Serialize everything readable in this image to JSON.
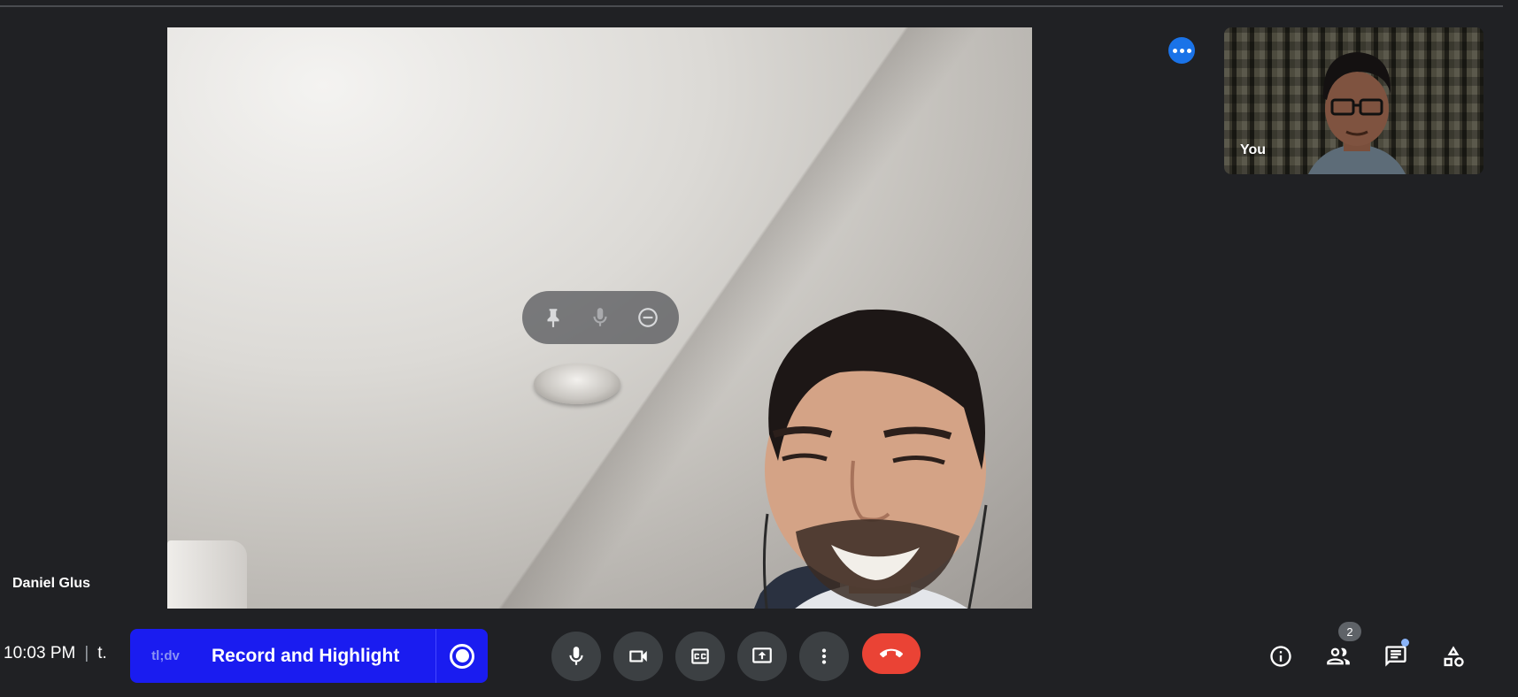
{
  "meeting": {
    "time": "10:03 PM",
    "separator": "|",
    "meeting_code": "t."
  },
  "main_tile": {
    "participant_name": "Daniel Glus",
    "controls": [
      "pin-icon",
      "mic-icon",
      "remove-icon"
    ]
  },
  "self_tile": {
    "label": "You"
  },
  "tldv": {
    "brand": "tl;dv",
    "record_label": "Record and Highlight",
    "brand_color": "#1a1cf0"
  },
  "controls": {
    "buttons": [
      "microphone",
      "camera",
      "captions",
      "present",
      "more-options",
      "leave-call"
    ],
    "end_call_color": "#ea4335"
  },
  "side_panel": {
    "people_count": "2",
    "icons": [
      "info-icon",
      "people-icon",
      "chat-icon",
      "activities-icon"
    ],
    "chat_notification_color": "#8ab4f8"
  },
  "colors": {
    "background": "#202124",
    "control_bg": "#3c4043",
    "accent": "#1a73e8"
  }
}
